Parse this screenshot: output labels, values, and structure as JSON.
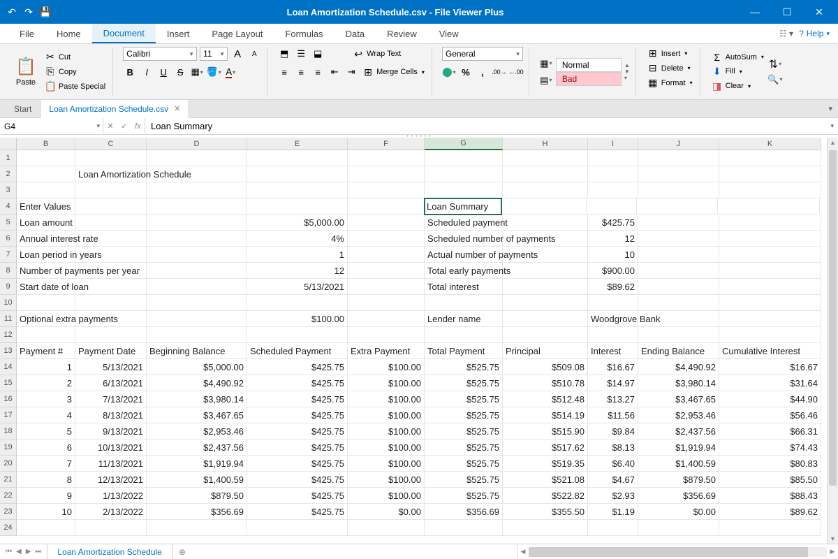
{
  "title": "Loan Amortization Schedule.csv - File Viewer Plus",
  "menus": [
    "File",
    "Home",
    "Document",
    "Insert",
    "Page Layout",
    "Formulas",
    "Data",
    "Review",
    "View"
  ],
  "active_menu": 2,
  "help": "Help",
  "doctabs": {
    "start": "Start",
    "file": "Loan Amortization Schedule.csv"
  },
  "namebox": "G4",
  "formula": "Loan Summary",
  "clipboard": {
    "paste": "Paste",
    "cut": "Cut",
    "copy": "Copy",
    "paste_special": "Paste Special"
  },
  "font": {
    "name": "Calibri",
    "size": "11"
  },
  "align": {
    "wrap": "Wrap Text",
    "merge": "Merge Cells"
  },
  "number_format": "General",
  "styles": {
    "normal": "Normal",
    "bad": "Bad"
  },
  "cells_grp": {
    "insert": "Insert",
    "delete": "Delete",
    "format": "Format"
  },
  "editing": {
    "autosum": "AutoSum",
    "fill": "Fill",
    "clear": "Clear"
  },
  "sheet_name": "Loan Amortization Schedule",
  "columns": [
    "B",
    "C",
    "D",
    "E",
    "F",
    "G",
    "H",
    "I",
    "J",
    "K"
  ],
  "selected_col": "G",
  "rows": 24,
  "document": {
    "title": "Loan Amortization Schedule",
    "labels": {
      "enter_values": "Enter Values",
      "loan_amount": "Loan amount",
      "annual_rate": "Annual interest rate",
      "loan_period": "Loan period in years",
      "num_pay_yr": "Number of payments per year",
      "start_date": "Start date of loan",
      "extra_pay": "Optional extra payments",
      "summary": "Loan Summary",
      "sched_pay": "Scheduled payment",
      "sched_num": "Scheduled number of payments",
      "actual_num": "Actual number of payments",
      "total_early": "Total early payments",
      "total_int": "Total interest",
      "lender": "Lender name"
    },
    "values": {
      "loan_amount": "$5,000.00",
      "annual_rate": "4%",
      "loan_period": "1",
      "num_pay_yr": "12",
      "start_date": "5/13/2021",
      "extra_pay": "$100.00",
      "sched_pay": "$425.75",
      "sched_num": "12",
      "actual_num": "10",
      "total_early": "$900.00",
      "total_int": "$89.62",
      "lender": "Woodgrove Bank"
    },
    "headers": [
      "Payment #",
      "Payment Date",
      "Beginning Balance",
      "Scheduled Payment",
      "Extra Payment",
      "Total Payment",
      "Principal",
      "Interest",
      "Ending Balance",
      "Cumulative Interest"
    ],
    "table": [
      [
        "1",
        "5/13/2021",
        "$5,000.00",
        "$425.75",
        "$100.00",
        "$525.75",
        "$509.08",
        "$16.67",
        "$4,490.92",
        "$16.67"
      ],
      [
        "2",
        "6/13/2021",
        "$4,490.92",
        "$425.75",
        "$100.00",
        "$525.75",
        "$510.78",
        "$14.97",
        "$3,980.14",
        "$31.64"
      ],
      [
        "3",
        "7/13/2021",
        "$3,980.14",
        "$425.75",
        "$100.00",
        "$525.75",
        "$512.48",
        "$13.27",
        "$3,467.65",
        "$44.90"
      ],
      [
        "4",
        "8/13/2021",
        "$3,467.65",
        "$425.75",
        "$100.00",
        "$525.75",
        "$514.19",
        "$11.56",
        "$2,953.46",
        "$56.46"
      ],
      [
        "5",
        "9/13/2021",
        "$2,953.46",
        "$425.75",
        "$100.00",
        "$525.75",
        "$515.90",
        "$9.84",
        "$2,437.56",
        "$66.31"
      ],
      [
        "6",
        "10/13/2021",
        "$2,437.56",
        "$425.75",
        "$100.00",
        "$525.75",
        "$517.62",
        "$8.13",
        "$1,919.94",
        "$74.43"
      ],
      [
        "7",
        "11/13/2021",
        "$1,919.94",
        "$425.75",
        "$100.00",
        "$525.75",
        "$519.35",
        "$6.40",
        "$1,400.59",
        "$80.83"
      ],
      [
        "8",
        "12/13/2021",
        "$1,400.59",
        "$425.75",
        "$100.00",
        "$525.75",
        "$521.08",
        "$4.67",
        "$879.50",
        "$85.50"
      ],
      [
        "9",
        "1/13/2022",
        "$879.50",
        "$425.75",
        "$100.00",
        "$525.75",
        "$522.82",
        "$2.93",
        "$356.69",
        "$88.43"
      ],
      [
        "10",
        "2/13/2022",
        "$356.69",
        "$425.75",
        "$0.00",
        "$356.69",
        "$355.50",
        "$1.19",
        "$0.00",
        "$89.62"
      ]
    ]
  }
}
